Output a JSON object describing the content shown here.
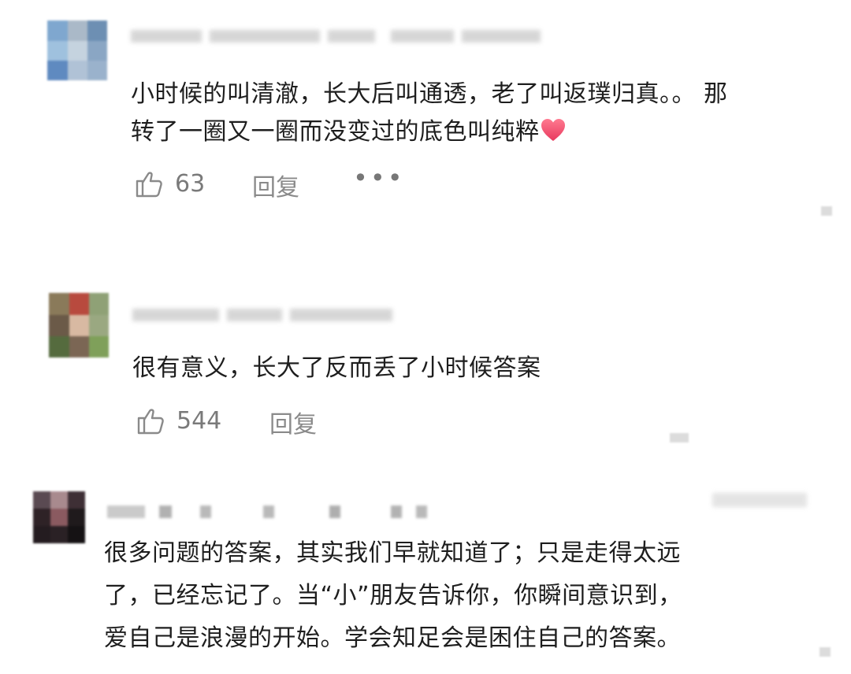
{
  "comments": [
    {
      "text_line1": "小时候的叫清澈，长大后叫通透，老了叫返璞归真。。 那",
      "text_line2": "转了一圈又一圈而没变过的底色叫纯粹",
      "emoji": "heart-icon",
      "likes": "63",
      "reply_label": "回复",
      "more_label": "•••"
    },
    {
      "text_line1": "很有意义，长大了反而丢了小时候答案",
      "likes": "544",
      "reply_label": "回复"
    },
    {
      "text_line1": "很多问题的答案，其实我们早就知道了；只是走得太远",
      "text_line2": "了，已经忘记了。当“小”朋友告诉你，你瞬间意识到，",
      "text_line3": "爱自己是浪漫的开始。学会知足会是困住自己的答案。"
    }
  ],
  "colors": {
    "text": "#1e1e1e",
    "muted": "#8a8a8a",
    "heart": "#f0506e"
  }
}
